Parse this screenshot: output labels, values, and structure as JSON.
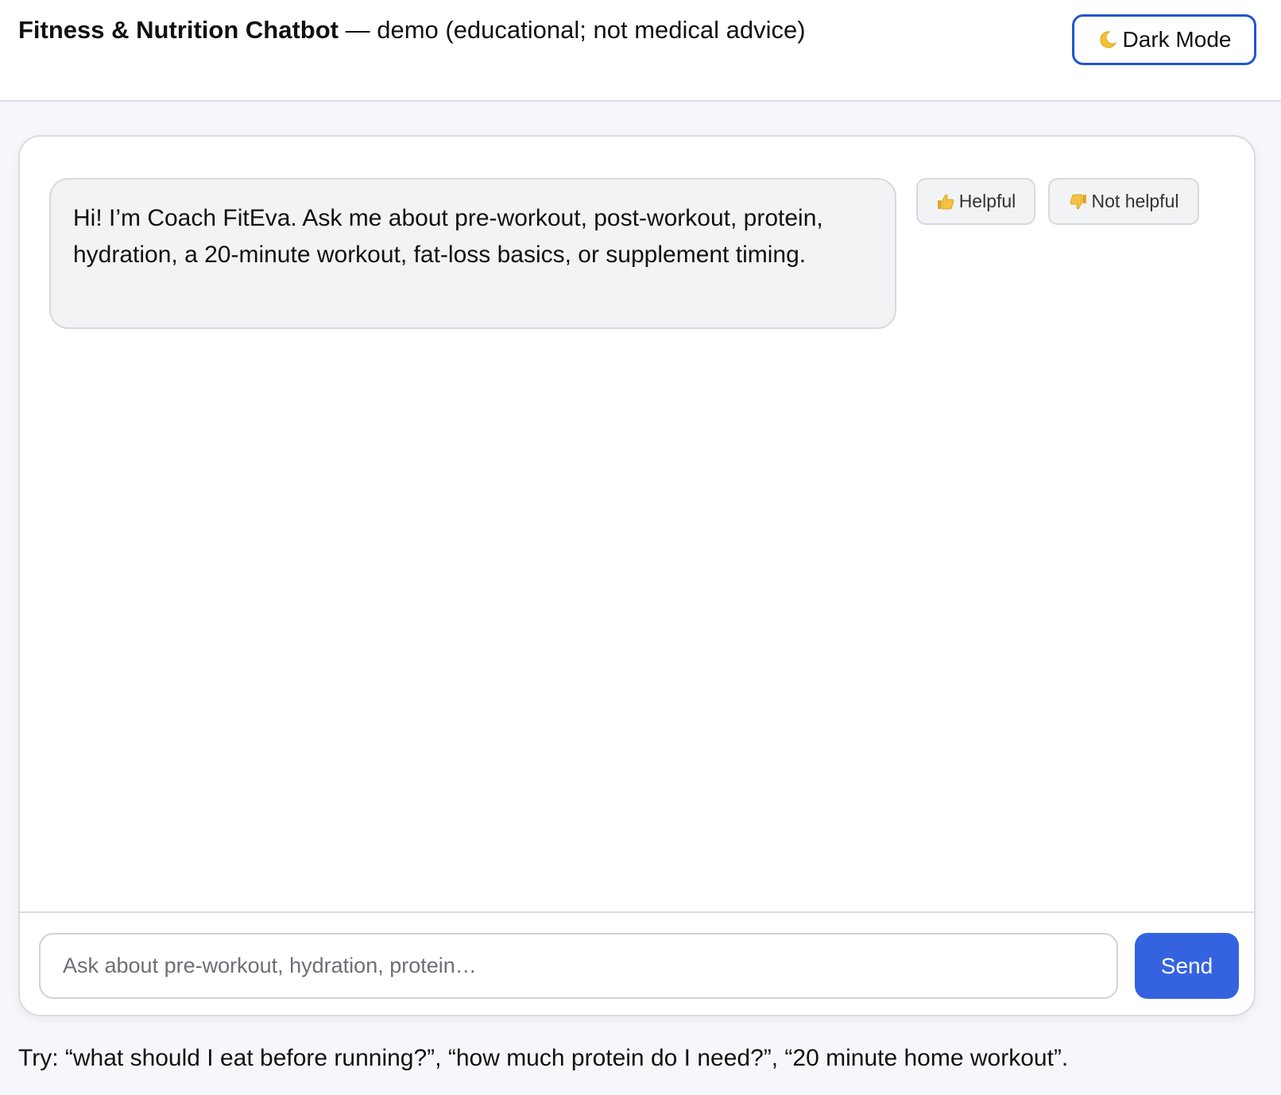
{
  "header": {
    "brand": "Fitness & Nutrition Chatbot",
    "subtitle": " — demo (educational; not medical advice)",
    "dark_mode_label": "Dark Mode",
    "dark_mode_icon": "moon-icon"
  },
  "chat": {
    "messages": [
      {
        "role": "bot",
        "text": "Hi! I’m Coach FitEva. Ask me about pre-workout, post-workout, protein, hydration, a 20-minute workout, fat-loss basics, or supplement timing."
      }
    ],
    "feedback": {
      "helpful_label": "Helpful",
      "helpful_icon": "thumbs-up-icon",
      "not_helpful_label": "Not helpful",
      "not_helpful_icon": "thumbs-down-icon"
    }
  },
  "composer": {
    "placeholder": "Ask about pre-workout, hydration, protein…",
    "value": "",
    "send_label": "Send"
  },
  "hint": "Try: “what should I eat before running?”, “how much protein do I need?”, “20 minute home workout”.",
  "colors": {
    "accent": "#3563e0",
    "dark_mode_border": "#2356c8",
    "page_background": "#f5f7fb",
    "bubble_background": "#f2f3f5"
  }
}
